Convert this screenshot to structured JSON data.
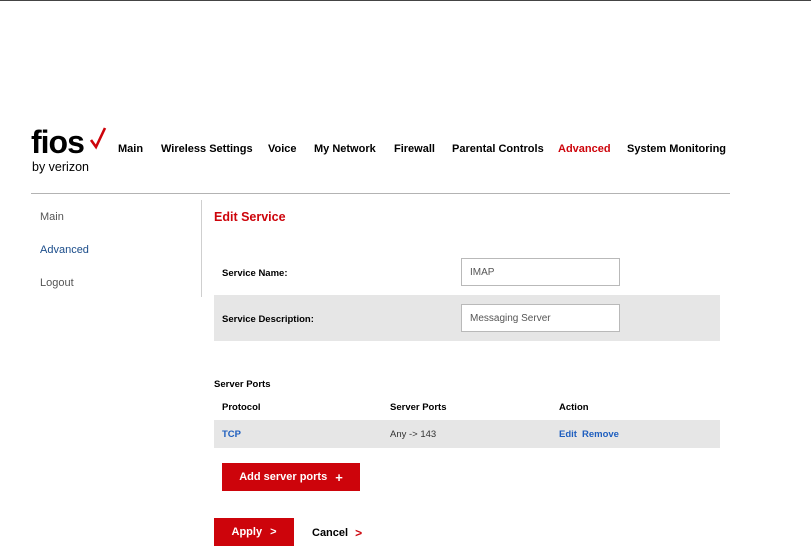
{
  "brand": {
    "name": "fios",
    "tagline": "by verizon",
    "check_color": "#cd040b"
  },
  "nav": {
    "items": [
      {
        "label": "Main"
      },
      {
        "label": "Wireless Settings"
      },
      {
        "label": "Voice"
      },
      {
        "label": "My Network"
      },
      {
        "label": "Firewall"
      },
      {
        "label": "Parental Controls"
      },
      {
        "label": "Advanced",
        "active": true
      },
      {
        "label": "System Monitoring"
      }
    ]
  },
  "sidebar": {
    "items": [
      {
        "label": "Main"
      },
      {
        "label": "Advanced",
        "active": true
      },
      {
        "label": "Logout"
      }
    ]
  },
  "page": {
    "title": "Edit Service"
  },
  "form": {
    "service_name_label": "Service Name:",
    "service_name_value": "IMAP",
    "service_description_label": "Service Description:",
    "service_description_value": "Messaging Server"
  },
  "ports": {
    "section_label": "Server Ports",
    "columns": [
      "Protocol",
      "Server Ports",
      "Action"
    ],
    "rows": [
      {
        "protocol": "TCP",
        "ports": "Any -> 143",
        "edit": "Edit",
        "remove": "Remove"
      }
    ],
    "add_label": "Add server ports"
  },
  "actions": {
    "apply_label": "Apply",
    "cancel_label": "Cancel"
  },
  "colors": {
    "accent": "#cd040b",
    "link": "#1f5fbf",
    "shaded_row": "#e6e6e6"
  }
}
